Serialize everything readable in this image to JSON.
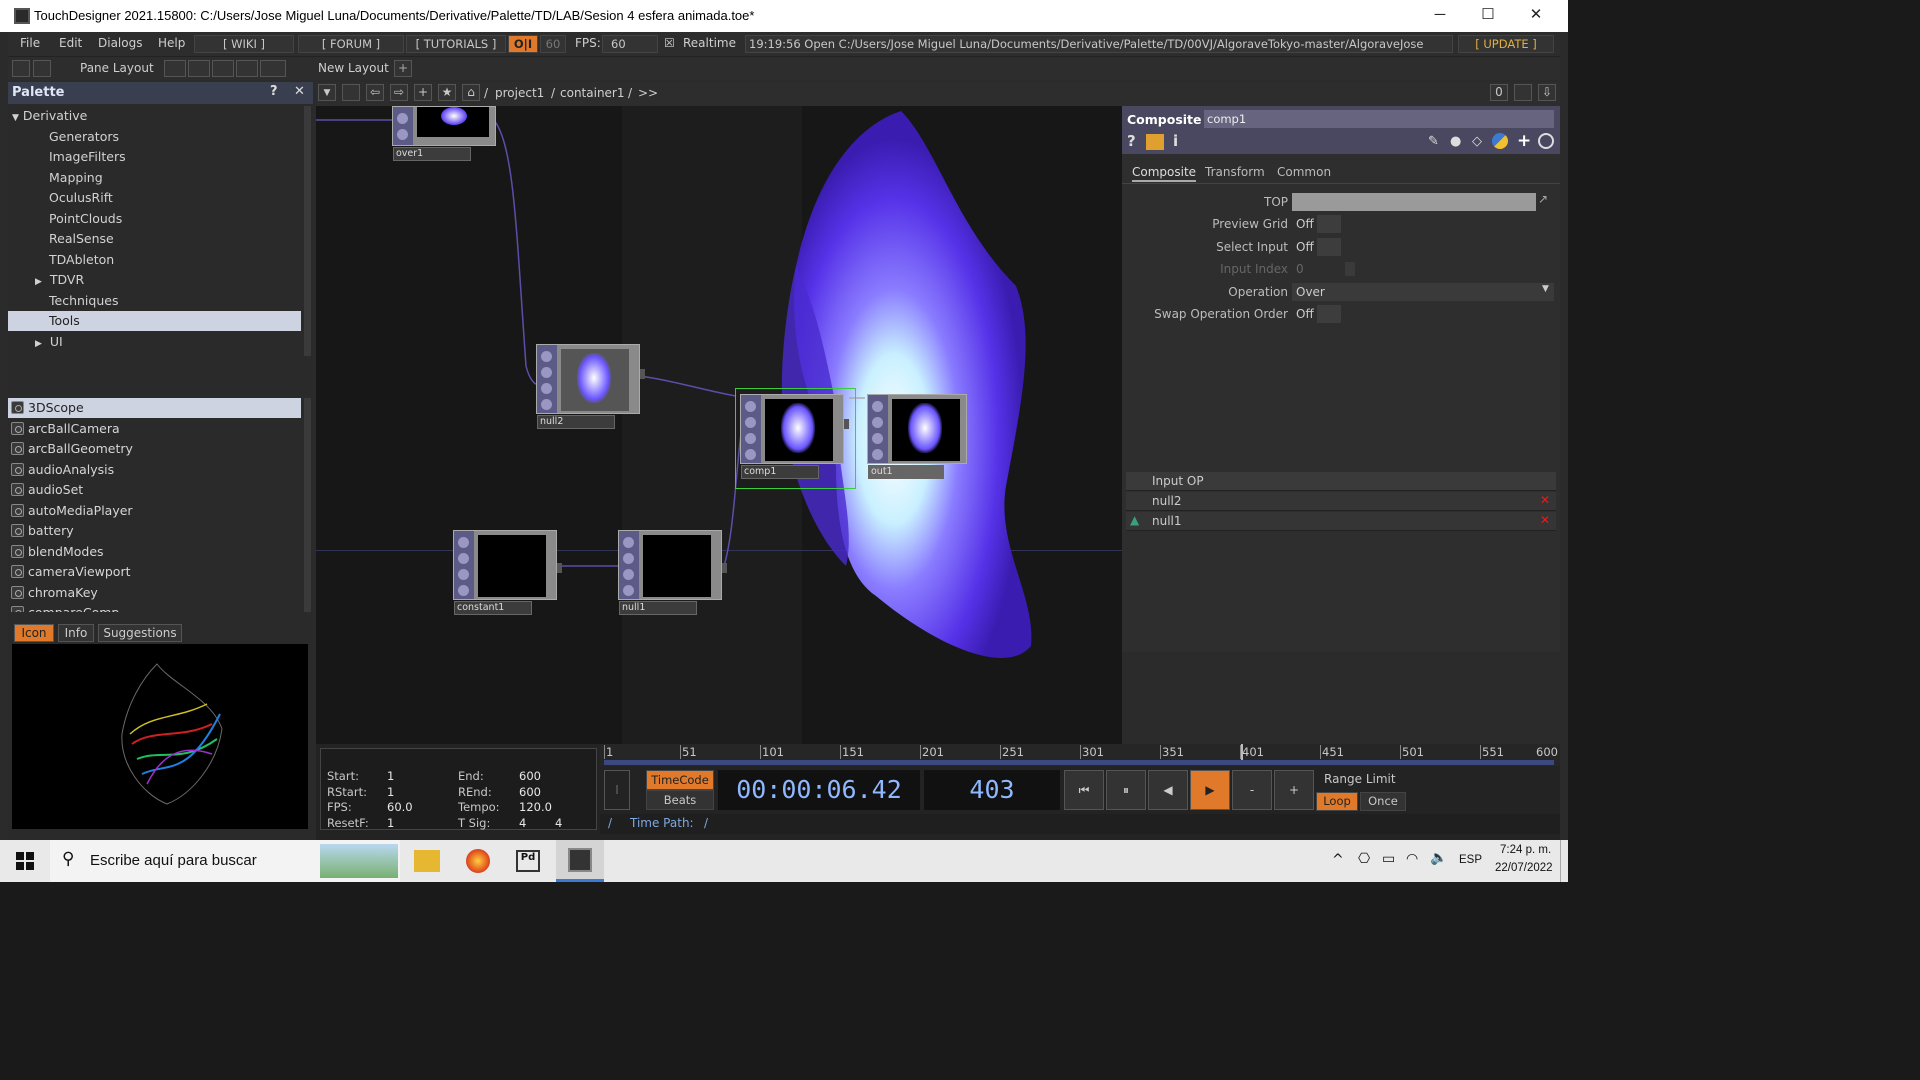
{
  "window": {
    "title": "TouchDesigner 2021.15800: C:/Users/Jose Miguel Luna/Documents/Derivative/Palette/TD/LAB/Sesion 4 esfera animada.toe*",
    "minimize": "─",
    "maximize": "☐",
    "close": "✕"
  },
  "menu": {
    "items": [
      "File",
      "Edit",
      "Dialogs",
      "Help"
    ],
    "wiki": "[ WIKI ]",
    "forum": "[ FORUM ]",
    "tutorials": "[ TUTORIALS ]",
    "oi": "O|I",
    "fps_cap": "60",
    "fps_label": "FPS:",
    "fps_value": "60",
    "realtime_check": "☒",
    "realtime": "Realtime",
    "log": "19:19:56 Open C:/Users/Jose Miguel Luna/Documents/Derivative/Palette/TD/00VJ/AlgoraveTokyo-master/AlgoraveJose",
    "update": "[ UPDATE ]"
  },
  "toolbar2": {
    "pane_layout": "Pane Layout",
    "new_layout": "New Layout",
    "plus": "+"
  },
  "palette": {
    "title": "Palette",
    "help": "?",
    "close": "✕",
    "root": "Derivative",
    "folders": [
      "Generators",
      "ImageFilters",
      "Mapping",
      "OculusRift",
      "PointClouds",
      "RealSense",
      "TDAbleton",
      "TDVR",
      "Techniques",
      "Tools",
      "UI"
    ],
    "selected_folder": "Tools",
    "items": [
      "3DScope",
      "arcBallCamera",
      "arcBallGeometry",
      "audioAnalysis",
      "audioSet",
      "autoMediaPlayer",
      "battery",
      "blendModes",
      "cameraViewport",
      "chromaKey",
      "compareComp"
    ],
    "selected_item": "3DScope",
    "tabs": [
      "Icon",
      "Info",
      "Suggestions"
    ],
    "active_tab": "Icon"
  },
  "nav": {
    "path_root": "/",
    "path1": "project1",
    "sep": "/",
    "path2": "container1",
    "path3": "/",
    "more": ">>",
    "right_num": "0"
  },
  "nodes": {
    "over1": "over1",
    "null2": "null2",
    "comp1": "comp1",
    "out1": "out1",
    "constant1": "constant1",
    "null1": "null1"
  },
  "params": {
    "op_type": "Composite",
    "op_name": "comp1",
    "help": "?",
    "info": "i",
    "tabs": [
      "Composite",
      "Transform",
      "Common"
    ],
    "active_tab": "Composite",
    "rows": [
      {
        "label": "TOP",
        "value": ""
      },
      {
        "label": "Preview Grid",
        "value": "Off"
      },
      {
        "label": "Select Input",
        "value": "Off"
      },
      {
        "label": "Input Index",
        "value": "0"
      },
      {
        "label": "Operation",
        "value": "Over"
      },
      {
        "label": "Swap Operation Order",
        "value": "Off"
      }
    ],
    "input_header": "Input OP",
    "inputs": [
      "null2",
      "null1"
    ],
    "remove": "✕"
  },
  "timeline": {
    "ruler": [
      "1",
      "51",
      "101",
      "151",
      "201",
      "251",
      "301",
      "351",
      "401",
      "451",
      "501",
      "551",
      "600"
    ],
    "start_label": "Start:",
    "start": "1",
    "end_label": "End:",
    "end": "600",
    "rstart_label": "RStart:",
    "rstart": "1",
    "rend_label": "REnd:",
    "rend": "600",
    "fps_label": "FPS:",
    "fps": "60.0",
    "tempo_label": "Tempo:",
    "tempo": "120.0",
    "resetf_label": "ResetF:",
    "resetf": "1",
    "tsig_label": "T Sig:",
    "tsig1": "4",
    "tsig2": "4",
    "timecode": "TimeCode",
    "beats": "Beats",
    "time": "00:00:06.42",
    "frame": "403",
    "range_limit": "Range Limit",
    "loop": "Loop",
    "once": "Once",
    "time_path_label": "Time Path:",
    "time_path": "/",
    "slash": "/",
    "minus": "-",
    "plus": "+"
  },
  "taskbar": {
    "search": "Escribe aquí para buscar",
    "lang": "ESP",
    "time": "7:24 p. m.",
    "date": "22/07/2022"
  },
  "colors": {
    "accent_orange": "#e07a2a",
    "node_purple": "#5c5a86",
    "selected_green": "#3ccf3c",
    "param_header": "#4a4860",
    "glow_blue": "#5a3ef0"
  }
}
